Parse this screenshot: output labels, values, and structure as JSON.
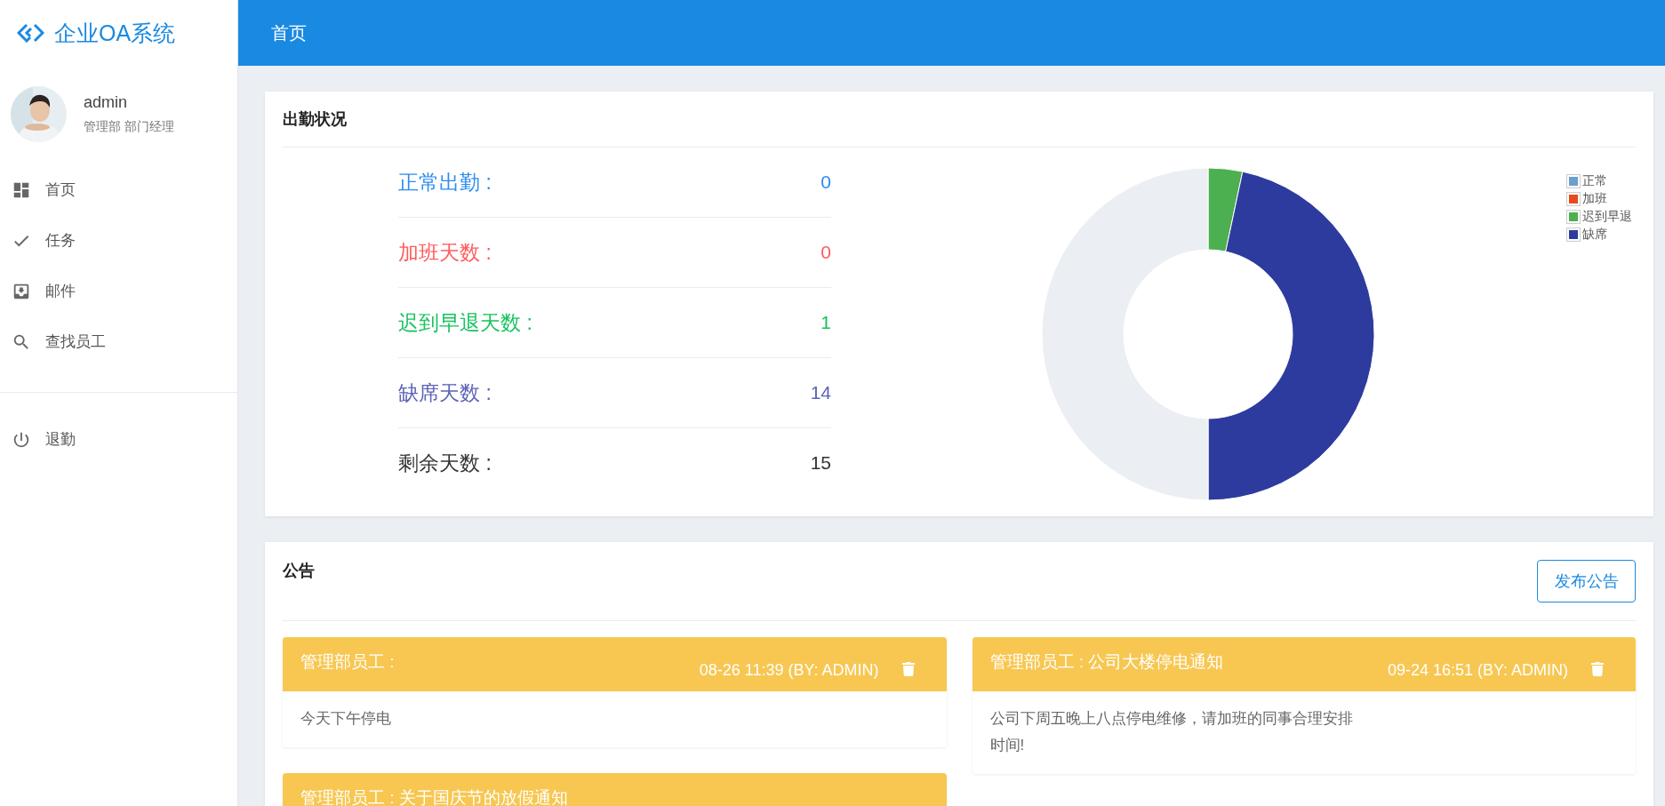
{
  "sidebar": {
    "logo": "企业OA系统",
    "user": {
      "name": "admin",
      "role": "管理部 部门经理"
    },
    "items": [
      {
        "label": "首页"
      },
      {
        "label": "任务"
      },
      {
        "label": "邮件"
      },
      {
        "label": "查找员工"
      }
    ],
    "footer_items": [
      {
        "label": "退勤"
      }
    ]
  },
  "header": {
    "title": "首页"
  },
  "attendance": {
    "title": "出勤状况",
    "stats": [
      {
        "label": "正常出勤 :",
        "value": "0",
        "color": "#2d8cf0"
      },
      {
        "label": "加班天数 :",
        "value": "0",
        "color": "#ff5b5b"
      },
      {
        "label": "迟到早退天数 :",
        "value": "1",
        "color": "#19c25f"
      },
      {
        "label": "缺席天数 :",
        "value": "14",
        "color": "#5c62b8"
      },
      {
        "label": "剩余天数 :",
        "value": "15",
        "color": "#333333"
      }
    ],
    "chart": {
      "chart_data": {
        "type": "donut",
        "categories": [
          "正常",
          "加班",
          "迟到早退",
          "缺席",
          null
        ],
        "values": [
          0,
          0,
          3.33,
          46.67,
          50
        ],
        "colors": [
          "#6aa0cb",
          "#e84a1c",
          "#4caf50",
          "#2e3b9e",
          "#ebeef3"
        ]
      }
    }
  },
  "notices": {
    "title": "公告",
    "button": "发布公告",
    "columns": [
      {
        "items": [
          {
            "title": "管理部员工 :",
            "date": "08-26 11:39 (BY: ADMIN)",
            "body": "今天下午停电"
          },
          {
            "title": "管理部员工 : 关于国庆节的放假通知"
          }
        ]
      },
      {
        "items": [
          {
            "title": "管理部员工 : 公司大楼停电通知",
            "date": "09-24 16:51 (BY: ADMIN)",
            "body": "公司下周五晚上八点停电维修，请加班的同事合理安排时间!"
          }
        ]
      }
    ]
  }
}
